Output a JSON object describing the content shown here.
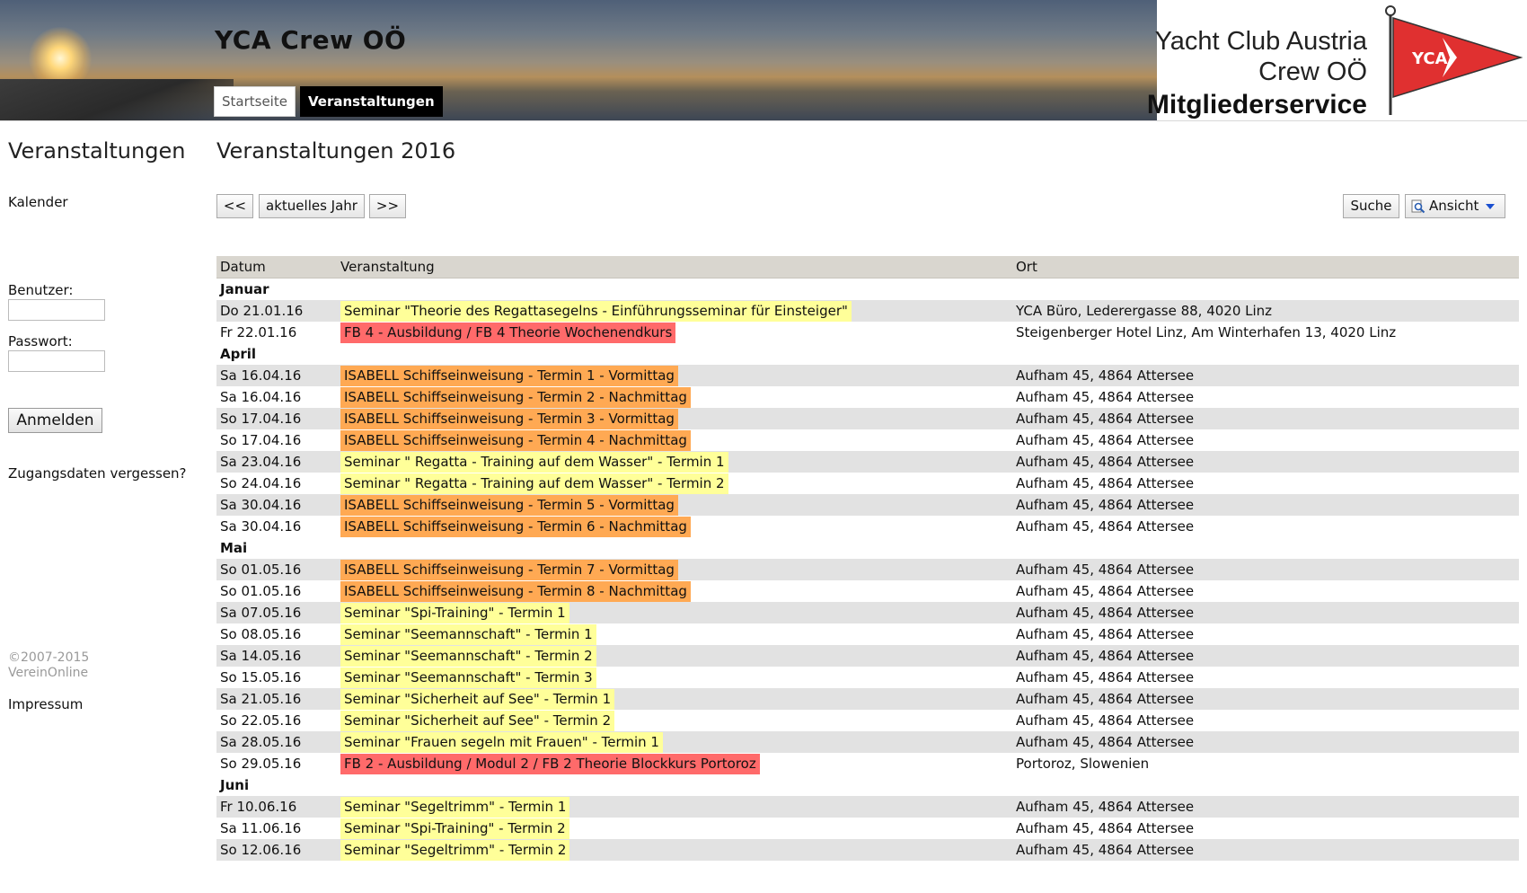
{
  "header": {
    "site_title": "YCA Crew OÖ",
    "tabs": [
      {
        "label": "Startseite",
        "active": false
      },
      {
        "label": "Veranstaltungen",
        "active": true
      }
    ],
    "logo": {
      "line1": "Yacht Club Austria",
      "line2": "Crew OÖ",
      "line3": "Mitgliederservice",
      "pennant_text": "YCA",
      "pennant_color": "#e03030"
    }
  },
  "sidebar": {
    "title": "Veranstaltungen",
    "calendar_link": "Kalender",
    "user_label": "Benutzer:",
    "password_label": "Passwort:",
    "user_value": "",
    "password_value": "",
    "login_button": "Anmelden",
    "forgot_link": "Zugangsdaten vergessen?",
    "copyright_line1": "©2007-2015",
    "copyright_line2": "VereinOnline",
    "impressum": "Impressum"
  },
  "main": {
    "title": "Veranstaltungen 2016",
    "toolbar": {
      "prev": "<<",
      "current": "aktuelles Jahr",
      "next": ">>",
      "search": "Suche",
      "view": "Ansicht"
    },
    "columns": [
      "Datum",
      "Veranstaltung",
      "Ort"
    ],
    "colors": {
      "yellow": "#ffff99",
      "orange": "#ffa953",
      "red": "#ff6a6a"
    },
    "months": [
      {
        "name": "Januar",
        "events": [
          {
            "date": "Do 21.01.16",
            "title": "Seminar \"Theorie des Regattasegelns - Einführungsseminar für Einsteiger\"",
            "place": "YCA Büro, Lederergasse 88, 4020 Linz",
            "color": "yellow"
          },
          {
            "date": "Fr 22.01.16",
            "title": "FB 4 - Ausbildung / FB 4 Theorie Wochenendkurs",
            "place": "Steigenberger Hotel Linz, Am Winterhafen 13, 4020 Linz",
            "color": "red"
          }
        ]
      },
      {
        "name": "April",
        "events": [
          {
            "date": "Sa 16.04.16",
            "title": "ISABELL Schiffseinweisung - Termin 1 - Vormittag",
            "place": "Aufham 45, 4864 Attersee",
            "color": "orange"
          },
          {
            "date": "Sa 16.04.16",
            "title": "ISABELL Schiffseinweisung - Termin 2 - Nachmittag",
            "place": "Aufham 45, 4864 Attersee",
            "color": "orange"
          },
          {
            "date": "So 17.04.16",
            "title": "ISABELL Schiffseinweisung - Termin 3 - Vormittag",
            "place": "Aufham 45, 4864 Attersee",
            "color": "orange"
          },
          {
            "date": "So 17.04.16",
            "title": "ISABELL Schiffseinweisung - Termin 4 - Nachmittag",
            "place": "Aufham 45, 4864 Attersee",
            "color": "orange"
          },
          {
            "date": "Sa 23.04.16",
            "title": "Seminar \" Regatta - Training auf dem Wasser\" - Termin 1",
            "place": "Aufham 45, 4864 Attersee",
            "color": "yellow"
          },
          {
            "date": "So 24.04.16",
            "title": "Seminar \" Regatta - Training auf dem Wasser\" - Termin 2",
            "place": "Aufham 45, 4864 Attersee",
            "color": "yellow"
          },
          {
            "date": "Sa 30.04.16",
            "title": "ISABELL Schiffseinweisung - Termin 5 - Vormittag",
            "place": "Aufham 45, 4864 Attersee",
            "color": "orange"
          },
          {
            "date": "Sa 30.04.16",
            "title": "ISABELL Schiffseinweisung - Termin 6 - Nachmittag",
            "place": "Aufham 45, 4864 Attersee",
            "color": "orange"
          }
        ]
      },
      {
        "name": "Mai",
        "events": [
          {
            "date": "So 01.05.16",
            "title": "ISABELL Schiffseinweisung - Termin 7 - Vormittag",
            "place": "Aufham 45, 4864 Attersee",
            "color": "orange"
          },
          {
            "date": "So 01.05.16",
            "title": "ISABELL Schiffseinweisung - Termin 8 - Nachmittag",
            "place": "Aufham 45, 4864 Attersee",
            "color": "orange"
          },
          {
            "date": "Sa 07.05.16",
            "title": "Seminar \"Spi-Training\" - Termin 1",
            "place": "Aufham 45, 4864 Attersee",
            "color": "yellow"
          },
          {
            "date": "So 08.05.16",
            "title": "Seminar \"Seemannschaft\" - Termin 1",
            "place": "Aufham 45, 4864 Attersee",
            "color": "yellow"
          },
          {
            "date": "Sa 14.05.16",
            "title": "Seminar \"Seemannschaft\" - Termin 2",
            "place": "Aufham 45, 4864 Attersee",
            "color": "yellow"
          },
          {
            "date": "So 15.05.16",
            "title": "Seminar \"Seemannschaft\" - Termin 3",
            "place": "Aufham 45, 4864 Attersee",
            "color": "yellow"
          },
          {
            "date": "Sa 21.05.16",
            "title": "Seminar \"Sicherheit auf See\" - Termin 1",
            "place": "Aufham 45, 4864 Attersee",
            "color": "yellow"
          },
          {
            "date": "So 22.05.16",
            "title": "Seminar \"Sicherheit auf See\" - Termin 2",
            "place": "Aufham 45, 4864 Attersee",
            "color": "yellow"
          },
          {
            "date": "Sa 28.05.16",
            "title": "Seminar \"Frauen segeln mit Frauen\" - Termin 1",
            "place": "Aufham 45, 4864 Attersee",
            "color": "yellow"
          },
          {
            "date": "So 29.05.16",
            "title": "FB 2 - Ausbildung / Modul 2 / FB 2 Theorie Blockkurs Portoroz",
            "place": "Portoroz, Slowenien",
            "color": "red"
          }
        ]
      },
      {
        "name": "Juni",
        "events": [
          {
            "date": "Fr 10.06.16",
            "title": "Seminar \"Segeltrimm\" - Termin 1",
            "place": "Aufham 45, 4864 Attersee",
            "color": "yellow"
          },
          {
            "date": "Sa 11.06.16",
            "title": "Seminar \"Spi-Training\" - Termin 2",
            "place": "Aufham 45, 4864 Attersee",
            "color": "yellow"
          },
          {
            "date": "So 12.06.16",
            "title": "Seminar \"Segeltrimm\" - Termin 2",
            "place": "Aufham 45, 4864 Attersee",
            "color": "yellow"
          }
        ]
      }
    ]
  }
}
